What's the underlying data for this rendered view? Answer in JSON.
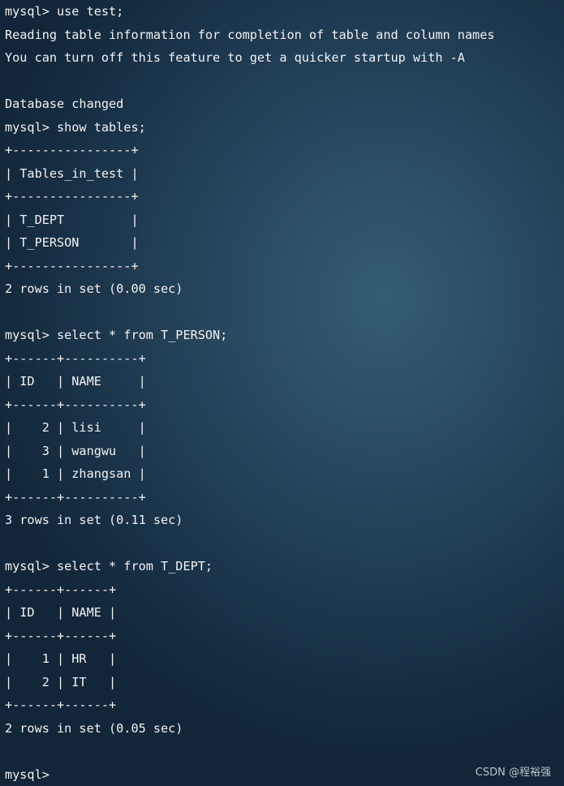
{
  "terminal": {
    "lines": [
      "mysql> use test;",
      "Reading table information for completion of table and column names",
      "You can turn off this feature to get a quicker startup with -A",
      "",
      "Database changed",
      "mysql> show tables;",
      "+----------------+",
      "| Tables_in_test |",
      "+----------------+",
      "| T_DEPT         |",
      "| T_PERSON       |",
      "+----------------+",
      "2 rows in set (0.00 sec)",
      "",
      "mysql> select * from T_PERSON;",
      "+------+----------+",
      "| ID   | NAME     |",
      "+------+----------+",
      "|    2 | lisi     |",
      "|    3 | wangwu   |",
      "|    1 | zhangsan |",
      "+------+----------+",
      "3 rows in set (0.11 sec)",
      "",
      "mysql> select * from T_DEPT;",
      "+------+------+",
      "| ID   | NAME |",
      "+------+------+",
      "|    1 | HR   |",
      "|    2 | IT   |",
      "+------+------+",
      "2 rows in set (0.05 sec)",
      "",
      "mysql> "
    ]
  },
  "watermark": "CSDN @程裕强"
}
